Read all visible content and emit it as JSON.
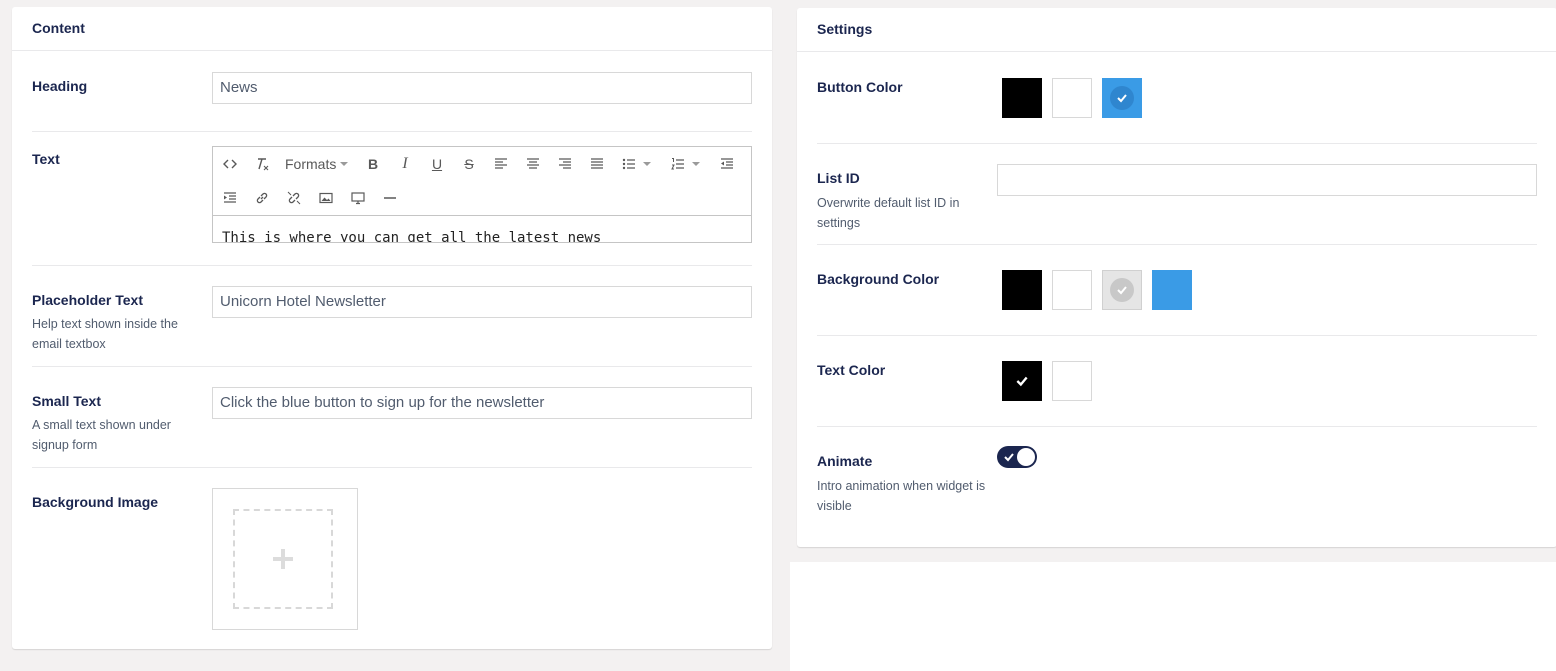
{
  "content": {
    "title": "Content",
    "heading": {
      "label": "Heading",
      "value": "News"
    },
    "text": {
      "label": "Text",
      "formats_label": "Formats",
      "body": "This is where you can get all the latest news"
    },
    "placeholder": {
      "label": "Placeholder Text",
      "description": "Help text shown inside the email textbox",
      "value": "Unicorn Hotel Newsletter"
    },
    "small_text": {
      "label": "Small Text",
      "description": "A small text shown under signup form",
      "value": "Click the blue button to sign up for the newsletter"
    },
    "background_image": {
      "label": "Background Image"
    }
  },
  "settings": {
    "title": "Settings",
    "button_color": {
      "label": "Button Color",
      "swatches": [
        "#000000",
        "#ffffff",
        "#3a9be6"
      ],
      "selected": 2
    },
    "list_id": {
      "label": "List ID",
      "description": "Overwrite default list ID in settings",
      "value": ""
    },
    "background_color": {
      "label": "Background Color",
      "swatches": [
        "#000000",
        "#ffffff",
        "#e5e5e5",
        "#3a9be6"
      ],
      "selected": 2
    },
    "text_color": {
      "label": "Text Color",
      "swatches": [
        "#000000",
        "#ffffff"
      ],
      "selected": 0
    },
    "animate": {
      "label": "Animate",
      "description": "Intro animation when widget is visible",
      "enabled": true
    }
  },
  "colors": {
    "navy": "#1b264f",
    "blue": "#3a9be6",
    "border": "#d8d8d8"
  }
}
